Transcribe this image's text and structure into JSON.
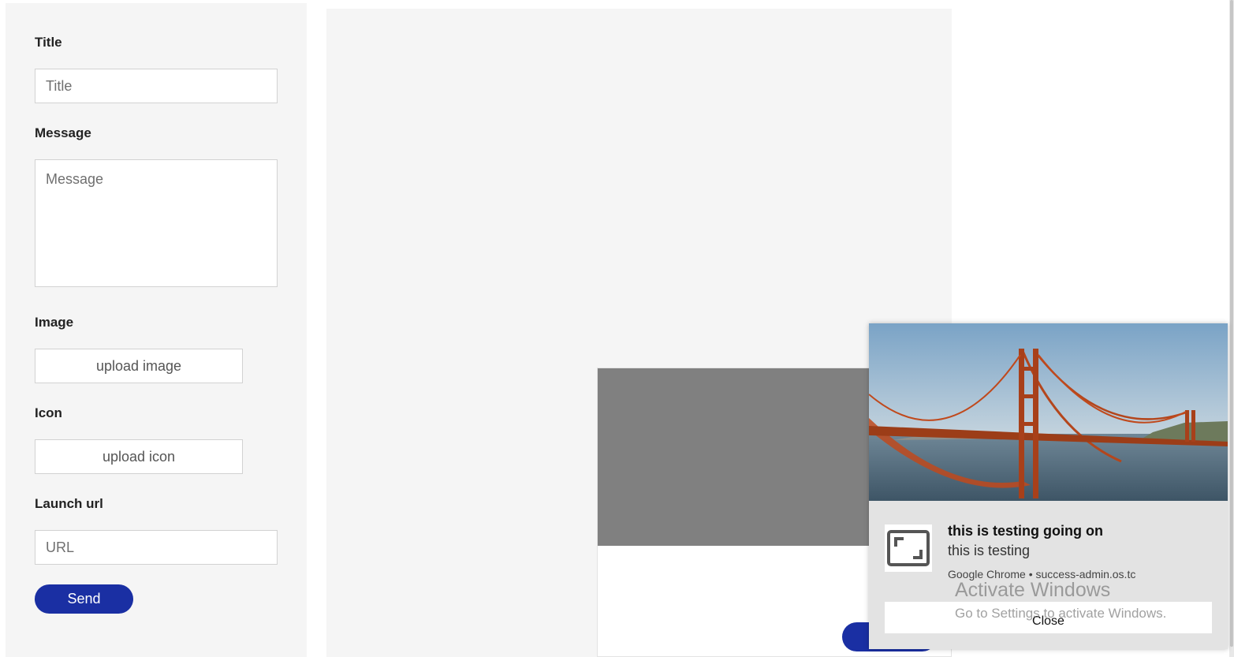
{
  "form": {
    "title_label": "Title",
    "title_placeholder": "Title",
    "message_label": "Message",
    "message_placeholder": "Message",
    "image_label": "Image",
    "upload_image_label": "upload image",
    "icon_label": "Icon",
    "upload_icon_label": "upload icon",
    "launch_url_label": "Launch url",
    "url_placeholder": "URL",
    "send_label": "Send"
  },
  "toast": {
    "title": "this is testing going on",
    "body": "this is testing",
    "source": "Google Chrome • success-admin.os.tc",
    "close_label": "Close",
    "app_icon": "expand-frame-icon",
    "hero_image": "golden-gate-bridge-photo"
  },
  "watermark": {
    "title": "Activate Windows",
    "subtitle": "Go to Settings to activate Windows."
  },
  "colors": {
    "primary": "#1a2fa3",
    "panel_bg": "#f5f5f5",
    "preview_image": "#808080"
  }
}
